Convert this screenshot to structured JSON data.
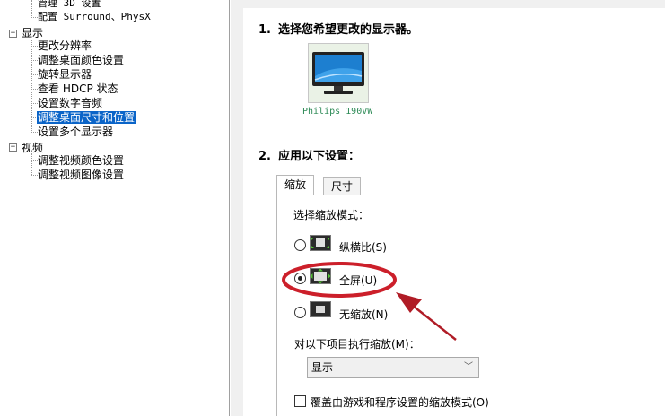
{
  "tree": {
    "items": [
      {
        "label": "管理 3D 设置",
        "mono": true
      },
      {
        "label": "配置 Surround、PhysX",
        "mono": true
      },
      {
        "label": "显示",
        "category": true
      },
      {
        "label": "更改分辨率"
      },
      {
        "label": "调整桌面颜色设置"
      },
      {
        "label": "旋转显示器"
      },
      {
        "label": "查看 HDCP 状态"
      },
      {
        "label": "设置数字音频"
      },
      {
        "label": "调整桌面尺寸和位置",
        "selected": true
      },
      {
        "label": "设置多个显示器"
      },
      {
        "label": "视频",
        "category": true
      },
      {
        "label": "调整视频颜色设置"
      },
      {
        "label": "调整视频图像设置"
      }
    ],
    "expanders": [
      "−",
      "−"
    ]
  },
  "section1": {
    "number": "1.",
    "title": "选择您希望更改的显示器。"
  },
  "monitor": {
    "label": "Philips 190VW"
  },
  "section2": {
    "number": "2.",
    "title": "应用以下设置："
  },
  "tabs": [
    {
      "label": "缩放",
      "active": true
    },
    {
      "label": "尺寸",
      "active": false
    }
  ],
  "scaling": {
    "mode_label": "选择缩放模式：",
    "options": [
      {
        "label": "纵横比(S)",
        "selected": false,
        "icon": "aspect-ratio-icon"
      },
      {
        "label": "全屏(U)",
        "selected": true,
        "icon": "fullscreen-icon"
      },
      {
        "label": "无缩放(N)",
        "selected": false,
        "icon": "no-scaling-icon"
      }
    ],
    "perform_label": "对以下项目执行缩放(M)：",
    "perform_value": "显示",
    "override_label": "覆盖由游戏和程序设置的缩放模式(O)",
    "override_checked": false
  },
  "colors": {
    "selection": "#0a64c8",
    "annotation": "#cc1f2a",
    "monitor_label": "#2e8b57"
  }
}
